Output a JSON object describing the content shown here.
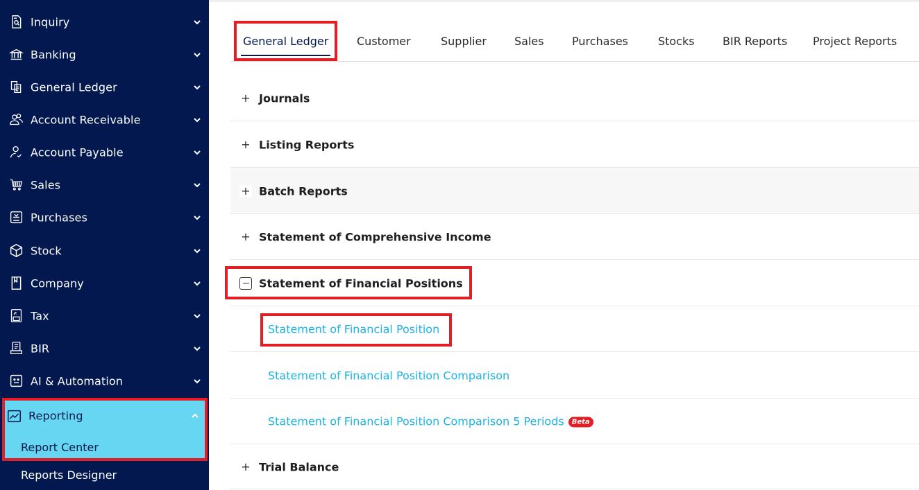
{
  "sidebar": {
    "items": [
      {
        "label": "Inquiry",
        "icon": "inquiry-icon"
      },
      {
        "label": "Banking",
        "icon": "bank-icon"
      },
      {
        "label": "General Ledger",
        "icon": "ledger-icon"
      },
      {
        "label": "Account Receivable",
        "icon": "users-icon"
      },
      {
        "label": "Account Payable",
        "icon": "user-check-icon"
      },
      {
        "label": "Sales",
        "icon": "cart-icon"
      },
      {
        "label": "Purchases",
        "icon": "purchase-icon"
      },
      {
        "label": "Stock",
        "icon": "box-icon"
      },
      {
        "label": "Company",
        "icon": "bookmark-icon"
      },
      {
        "label": "Tax",
        "icon": "tax-icon"
      },
      {
        "label": "BIR",
        "icon": "bir-icon"
      },
      {
        "label": "AI & Automation",
        "icon": "robot-icon"
      },
      {
        "label": "Reporting",
        "icon": "chart-line-icon"
      }
    ],
    "reporting_sub": {
      "report_center": "Report Center",
      "reports_designer": "Reports Designer"
    },
    "colors": {
      "bg": "#02184f",
      "active_bg": "#67d6f2",
      "highlight": "#e31e24"
    }
  },
  "tabs": [
    {
      "label": "General Ledger",
      "active": true
    },
    {
      "label": "Customer"
    },
    {
      "label": "Supplier"
    },
    {
      "label": "Sales"
    },
    {
      "label": "Purchases"
    },
    {
      "label": "Stocks"
    },
    {
      "label": "BIR Reports"
    },
    {
      "label": "Project Reports"
    }
  ],
  "sections": {
    "journals": "Journals",
    "listing_reports": "Listing Reports",
    "batch_reports": "Batch Reports",
    "comprehensive_income": "Statement of Comprehensive Income",
    "financial_positions": "Statement of Financial Positions",
    "trial_balance": "Trial Balance"
  },
  "links": {
    "sfp": "Statement of Financial Position",
    "sfp_comparison": "Statement of Financial Position Comparison",
    "sfp_comparison_5": "Statement of Financial Position Comparison 5 Periods",
    "beta_badge": "Beta"
  },
  "toggles": {
    "expand": "+"
  }
}
